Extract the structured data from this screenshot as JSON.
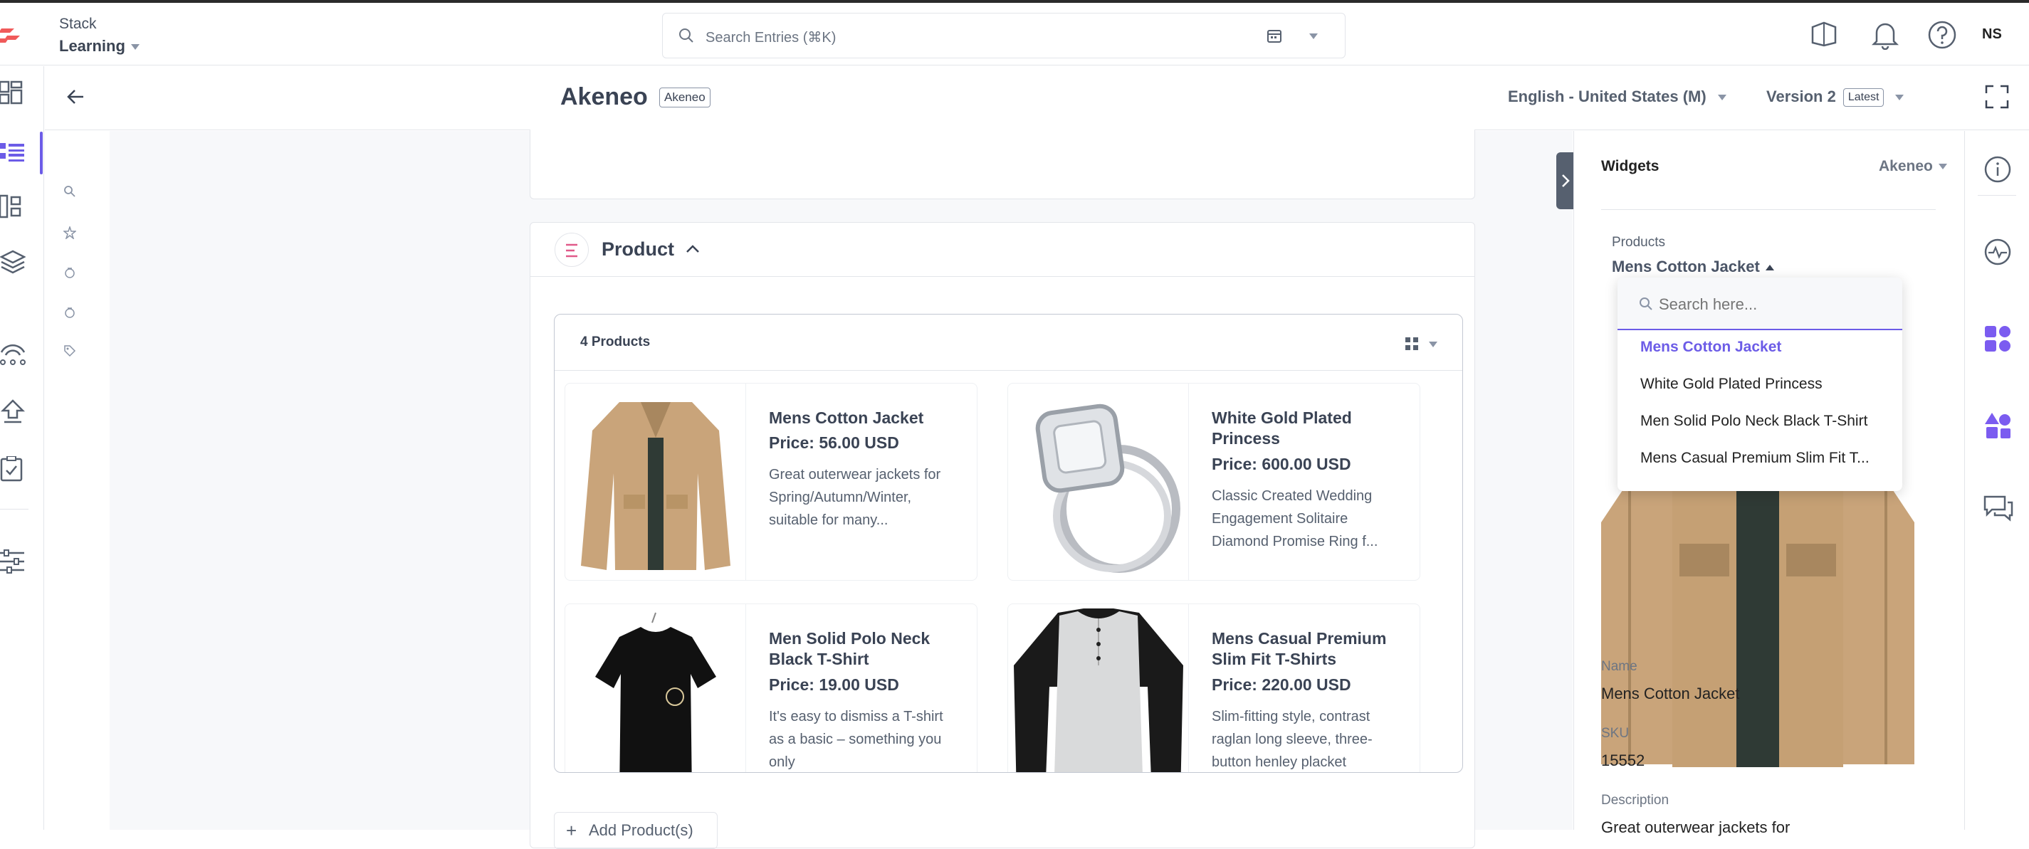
{
  "header": {
    "stack_name": "Stack",
    "branch": "Learning",
    "search_placeholder": "Search Entries (⌘K)",
    "avatar": "NS"
  },
  "entry": {
    "title": "Akeneo",
    "content_type_tag": "Akeneo",
    "locale": "English - United States (M)",
    "version": "Version 2",
    "version_tag": "Latest"
  },
  "product_section": {
    "title": "Product",
    "count_label": "4 Products",
    "add_button": "Add Product(s)",
    "products": [
      {
        "name": "Mens Cotton Jacket",
        "price": "Price: 56.00 USD",
        "description": "Great outerwear jackets for Spring/Autumn/Winter, suitable for many..."
      },
      {
        "name": "White Gold Plated Princess",
        "price": "Price: 600.00 USD",
        "description": "Classic Created Wedding Engagement Solitaire Diamond Promise Ring f..."
      },
      {
        "name": "Men Solid Polo Neck Black T-Shirt",
        "price": "Price: 19.00 USD",
        "description": "It's easy to dismiss a T-shirt as a basic – something you only"
      },
      {
        "name": "Mens Casual Premium Slim Fit T-Shirts",
        "price": "Price: 220.00 USD",
        "description": "Slim-fitting style, contrast raglan long sleeve, three-button henley placket"
      }
    ]
  },
  "widgets": {
    "title": "Widgets",
    "selected_widget": "Akeneo",
    "products_label": "Products",
    "selected_product": "Mens Cotton Jacket",
    "dropdown": {
      "search_placeholder": "Search here...",
      "options": [
        "Mens Cotton Jacket",
        "White Gold Plated Princess",
        "Men Solid Polo Neck Black T-Shirt",
        "Mens Casual Premium Slim Fit T..."
      ]
    },
    "fields": {
      "name_label": "Name",
      "name_value": "Mens Cotton Jacket",
      "sku_label": "SKU",
      "sku_value": "15552",
      "description_label": "Description",
      "description_value": "Great outerwear jackets for"
    }
  },
  "colors": {
    "accent": "#6c5ce7",
    "logo": "#f05a5a",
    "text": "#3a4354"
  }
}
